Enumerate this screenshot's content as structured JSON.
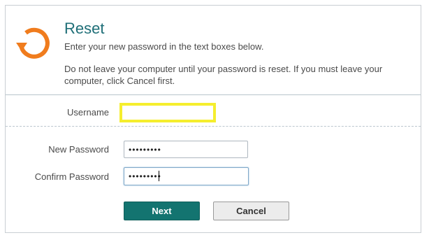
{
  "header": {
    "title": "Reset",
    "subtitle": "Enter your new password in the text boxes below.",
    "warning": "Do not leave your computer until your password is reset. If you must leave your computer, click Cancel first.",
    "icon": "reset-icon"
  },
  "form": {
    "username_label": "Username",
    "username_value": "",
    "new_password_label": "New Password",
    "new_password_value": "•••••••••",
    "confirm_password_label": "Confirm Password",
    "confirm_password_value": "•••••••••"
  },
  "buttons": {
    "next_label": "Next",
    "cancel_label": "Cancel"
  },
  "colors": {
    "accent": "#137470",
    "title": "#1f6f78",
    "icon": "#f07c1d",
    "highlight": "#f5ee2e"
  }
}
